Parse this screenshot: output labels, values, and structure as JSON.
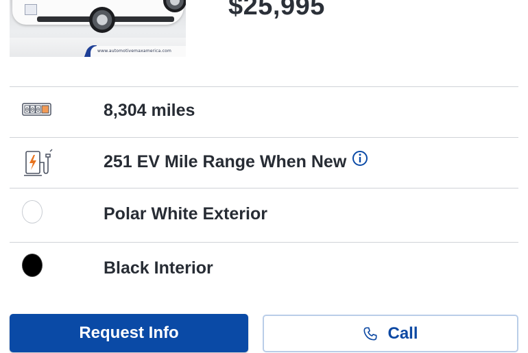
{
  "listing": {
    "price": "$25,995",
    "photo": {
      "dealer_watermark": "www.automotivemaxamerica.com"
    }
  },
  "specs": [
    {
      "icon": "odometer-icon",
      "text": "8,304 miles"
    },
    {
      "icon": "ev-charger-icon",
      "text": "251 EV Mile Range When New",
      "info_icon": "info-icon"
    },
    {
      "icon": "white-color-swatch",
      "text": "Polar White Exterior",
      "swatch_color": "#ffffff"
    },
    {
      "icon": "black-color-swatch",
      "text": "Black Interior",
      "swatch_color": "#000000"
    }
  ],
  "actions": {
    "request_info_label": "Request Info",
    "call_label": "Call",
    "call_icon": "phone-icon"
  },
  "colors": {
    "primary": "#0a4aa6",
    "secondary_border": "#b9cde8",
    "text": "#272c34",
    "divider": "#cfd2d7",
    "accent_orange": "#e8731e"
  }
}
